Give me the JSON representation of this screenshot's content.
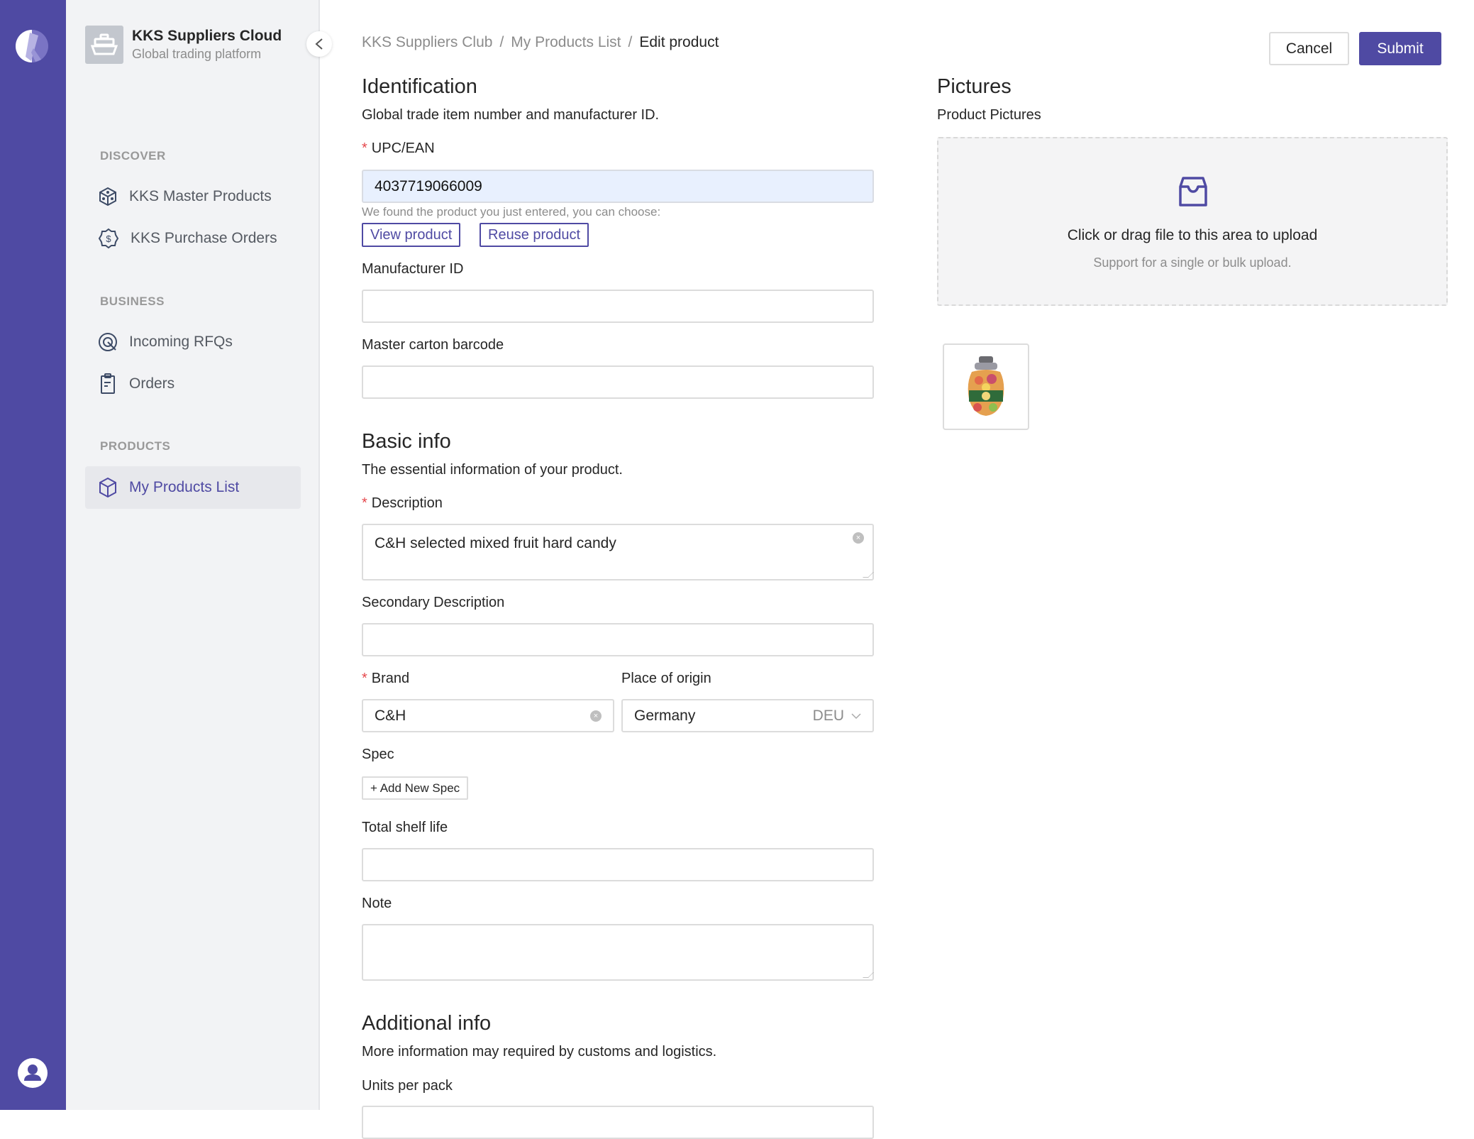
{
  "app": {
    "brand_title": "KKS Suppliers Cloud",
    "brand_subtitle": "Global trading platform",
    "accent_color": "#4f4aa3"
  },
  "sidebar": {
    "sections": [
      {
        "label": "DISCOVER",
        "items": [
          {
            "label": "KKS Master Products",
            "icon": "cube-dots-icon",
            "active": false
          },
          {
            "label": "KKS Purchase Orders",
            "icon": "dollar-badge-icon",
            "active": false
          }
        ]
      },
      {
        "label": "BUSINESS",
        "items": [
          {
            "label": "Incoming RFQs",
            "icon": "target-icon",
            "active": false
          },
          {
            "label": "Orders",
            "icon": "clipboard-icon",
            "active": false
          }
        ]
      },
      {
        "label": "PRODUCTS",
        "items": [
          {
            "label": "My Products List",
            "icon": "cube-icon",
            "active": true
          }
        ]
      }
    ]
  },
  "breadcrumb": [
    "KKS Suppliers Club",
    "My Products List",
    "Edit product"
  ],
  "breadcrumb_separator": "/",
  "actions": {
    "cancel_label": "Cancel",
    "submit_label": "Submit"
  },
  "identification": {
    "title": "Identification",
    "subtitle": "Global trade item number and manufacturer ID.",
    "upc_label": "UPC/EAN",
    "upc_value": "4037719066009",
    "found_hint": "We found the product you just entered, you can choose:",
    "view_product_label": "View product",
    "reuse_product_label": "Reuse product",
    "manufacturer_label": "Manufacturer ID",
    "manufacturer_value": "",
    "carton_label": "Master carton barcode",
    "carton_value": ""
  },
  "basic_info": {
    "title": "Basic info",
    "subtitle": "The essential information of your product.",
    "description_label": "Description",
    "description_value": "C&H selected mixed fruit hard candy",
    "secondary_label": "Secondary Description",
    "secondary_value": "",
    "brand_label": "Brand",
    "brand_value": "C&H",
    "origin_label": "Place of origin",
    "origin_value": "Germany",
    "origin_code": "DEU",
    "spec_label": "Spec",
    "add_spec_label": "+ Add New Spec",
    "shelf_life_label": "Total shelf life",
    "shelf_life_value": "",
    "note_label": "Note",
    "note_value": ""
  },
  "additional_info": {
    "title": "Additional info",
    "subtitle": "More information may required by customs and logistics.",
    "units_label": "Units per pack"
  },
  "pictures": {
    "title": "Pictures",
    "subtitle": "Product Pictures",
    "upload_text": "Click or drag file to this area to upload",
    "upload_hint": "Support for a single or bulk upload.",
    "thumbnails": [
      {
        "alt": "candy jar product image"
      }
    ]
  }
}
